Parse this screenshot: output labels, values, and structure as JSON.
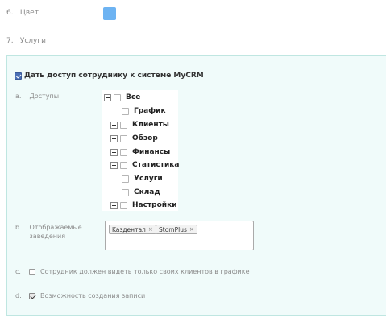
{
  "fields": {
    "color": {
      "num": "6.",
      "label": "Цвет",
      "value": "#6db3f2"
    },
    "services": {
      "num": "7.",
      "label": "Услуги"
    }
  },
  "panel": {
    "access_checkbox_label": "Дать доступ сотруднику к системе MyCRM",
    "access_checked": true,
    "access": {
      "num": "a.",
      "label": "Доступы"
    },
    "tree": {
      "root": "Все",
      "items": [
        {
          "label": "График",
          "expandable": false
        },
        {
          "label": "Клиенты",
          "expandable": true
        },
        {
          "label": "Обзор",
          "expandable": true
        },
        {
          "label": "Финансы",
          "expandable": true
        },
        {
          "label": "Статистика",
          "expandable": true
        },
        {
          "label": "Услуги",
          "expandable": false
        },
        {
          "label": "Склад",
          "expandable": false
        },
        {
          "label": "Настройки",
          "expandable": true
        }
      ]
    },
    "establishments": {
      "num": "b.",
      "label_line1": "Отображаемые",
      "label_line2": "заведения",
      "tags": [
        "Kaздентал",
        "StomPlus"
      ],
      "remove_glyph": "×"
    },
    "option_c": {
      "num": "c.",
      "label": "Сотрудник должен видеть только своих клиентов в графике",
      "checked": false
    },
    "option_d": {
      "num": "d.",
      "label": "Возможность создания записи",
      "checked": true
    }
  }
}
